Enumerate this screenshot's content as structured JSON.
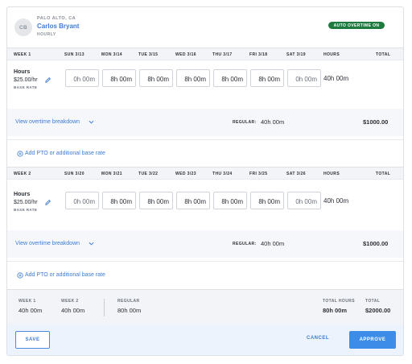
{
  "employee": {
    "initials": "CB",
    "location": "PALO ALTO, CA",
    "name": "Carlos Bryant",
    "pay_type": "HOURLY",
    "overtime_badge": "AUTO OVERTIME ON"
  },
  "weeks": [
    {
      "label": "WEEK 1",
      "days": [
        "SUN 3/13",
        "MON 3/14",
        "TUE 3/15",
        "WED 3/16",
        "THU 3/17",
        "FRI 3/18",
        "SAT 3/19"
      ],
      "hours_header": "HOURS",
      "total_header": "TOTAL",
      "row_title": "Hours",
      "rate": "$25.00/hr",
      "rate_label": "BASE RATE",
      "entries": [
        "0h  00m",
        "8h  00m",
        "8h  00m",
        "8h  00m",
        "8h  00m",
        "8h  00m",
        "0h  00m"
      ],
      "row_hours": "40h 00m",
      "overtime_link": "View overtime breakdown",
      "regular_label": "REGULAR:",
      "regular_value": "40h 00m",
      "amount": "$1000.00",
      "add_link": "Add PTO or additional base rate"
    },
    {
      "label": "WEEK 2",
      "days": [
        "SUN 3/20",
        "MON 3/21",
        "TUE 3/22",
        "WED 3/23",
        "THU 3/24",
        "FRI 3/25",
        "SAT 3/26"
      ],
      "hours_header": "HOURS",
      "total_header": "TOTAL",
      "row_title": "Hours",
      "rate": "$25.00/hr",
      "rate_label": "BASE RATE",
      "entries": [
        "0h  00m",
        "8h  00m",
        "8h  00m",
        "8h  00m",
        "8h  00m",
        "8h  00m",
        "0h  00m"
      ],
      "row_hours": "40h 00m",
      "overtime_link": "View overtime breakdown",
      "regular_label": "REGULAR:",
      "regular_value": "40h 00m",
      "amount": "$1000.00",
      "add_link": "Add PTO or additional base rate"
    }
  ],
  "summary": {
    "week1_label": "WEEK 1",
    "week1_value": "40h 00m",
    "week2_label": "WEEK 2",
    "week2_value": "40h 00m",
    "regular_label": "REGULAR",
    "regular_value": "80h 00m",
    "total_hours_label": "TOTAL HOURS",
    "total_hours_value": "80h 00m",
    "total_label": "TOTAL",
    "total_value": "$2000.00"
  },
  "actions": {
    "save": "SAVE",
    "cancel": "CANCEL",
    "approve": "APPROVE"
  },
  "colors": {
    "accent": "#3d7bd4",
    "badge_green": "#1f7a3f",
    "approve_bg": "#3d8ce8"
  },
  "icons": [
    "edit-pencil-icon",
    "chevron-down-icon",
    "add-circle-icon"
  ]
}
